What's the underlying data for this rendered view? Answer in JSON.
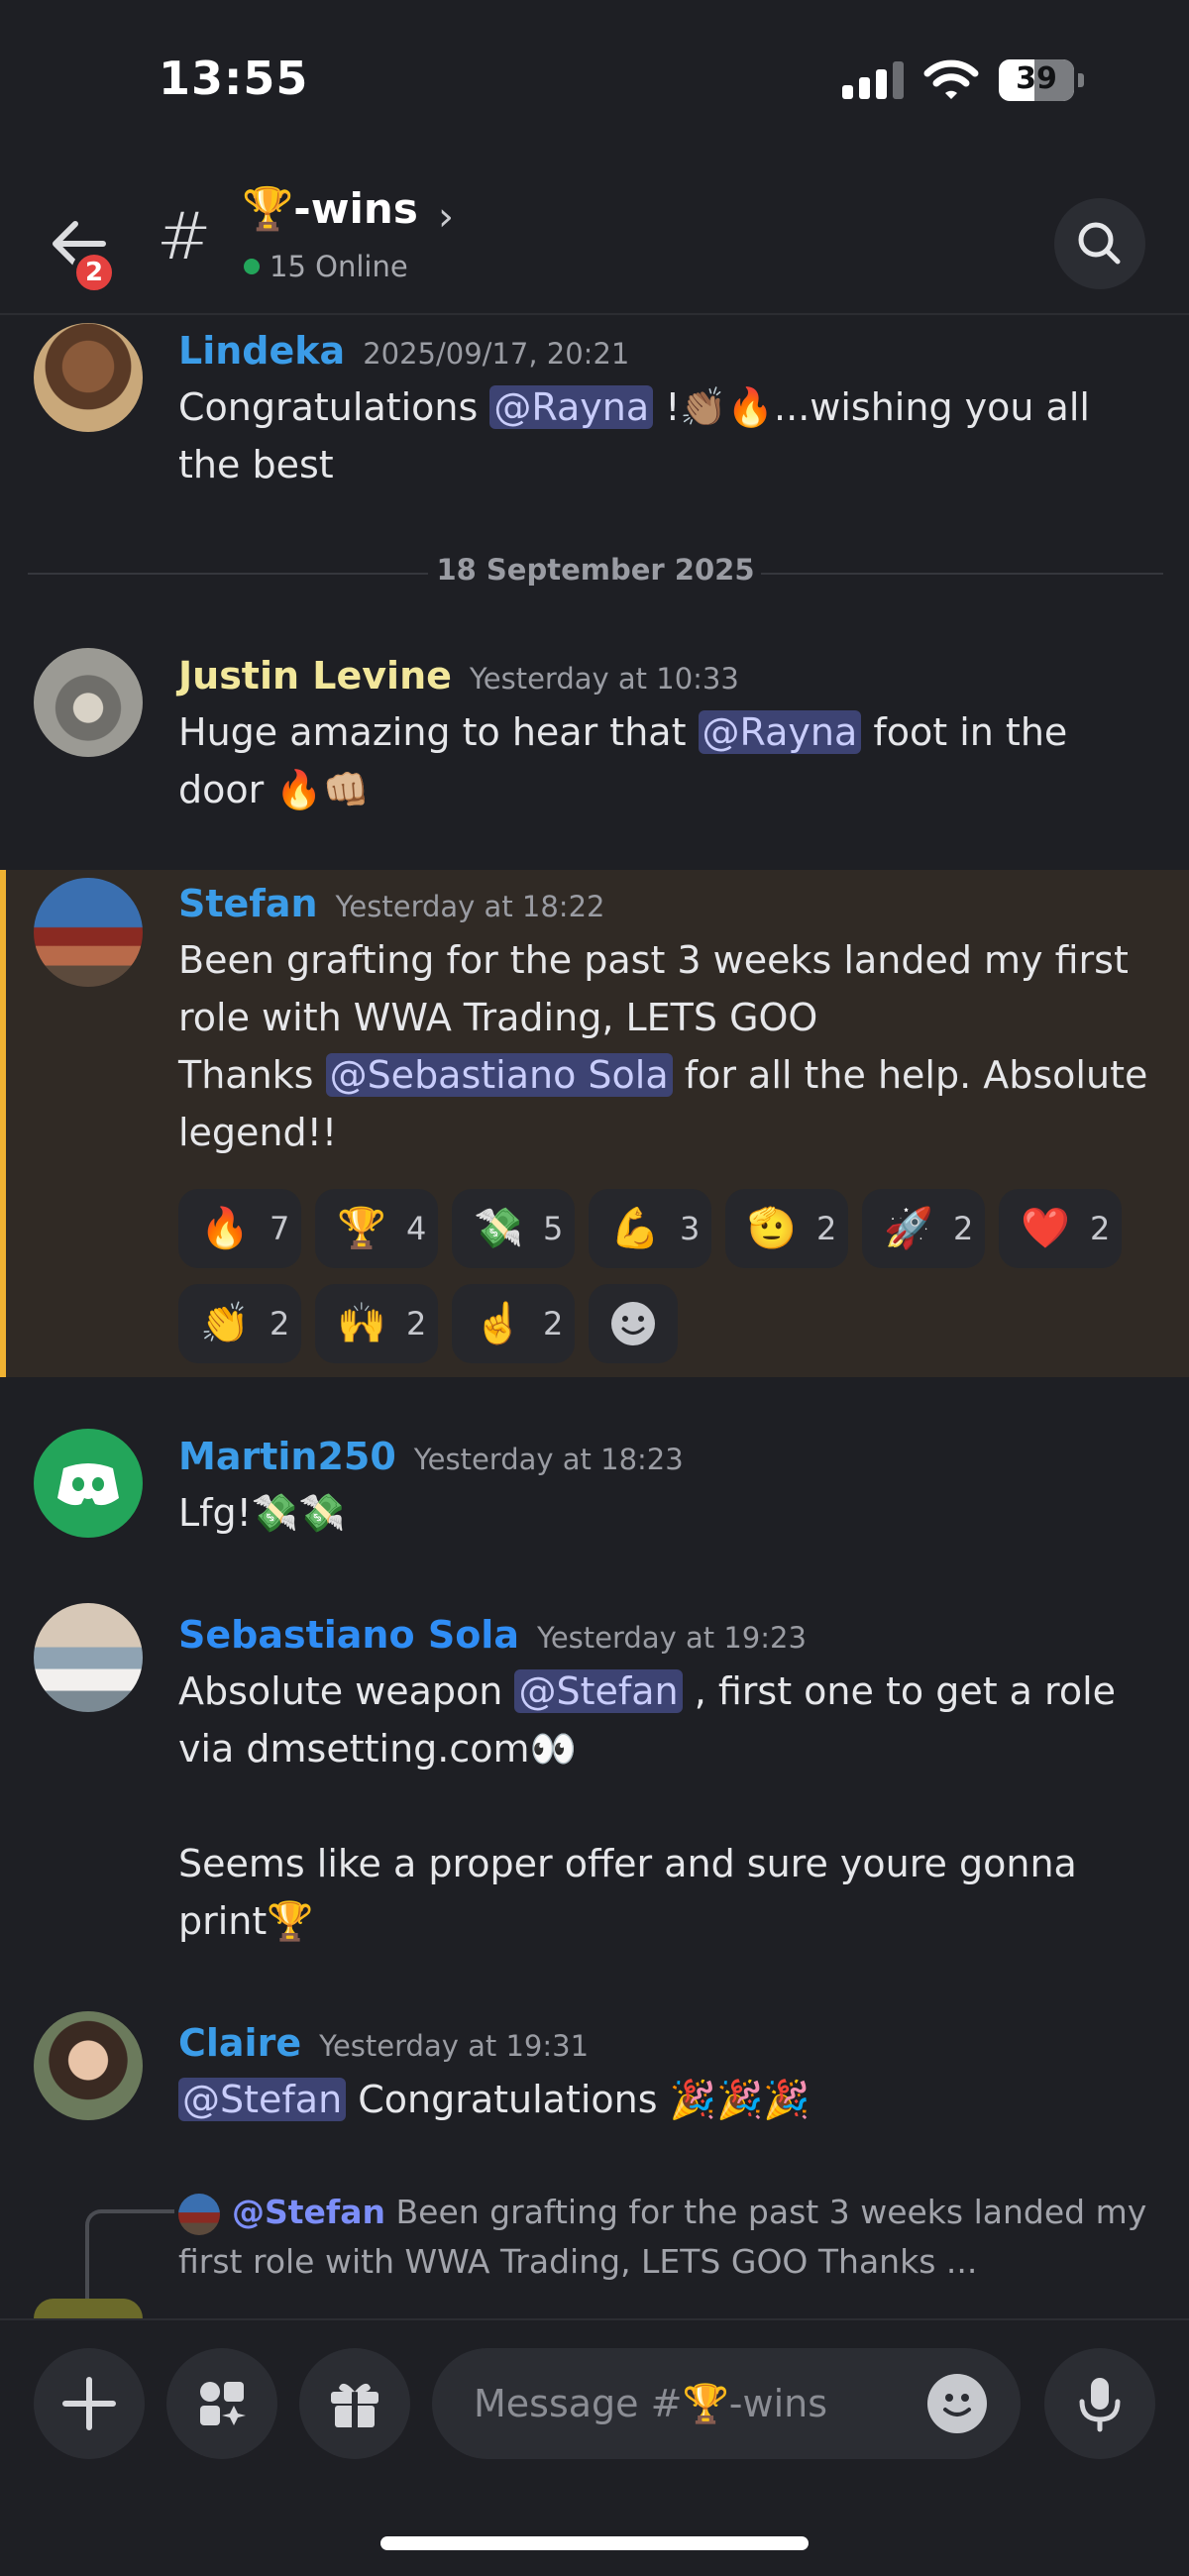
{
  "status_bar": {
    "time": "13:55",
    "battery": "39"
  },
  "header": {
    "back_badge": "2",
    "channel_name": "🏆-wins",
    "online": "15 Online"
  },
  "messages": [
    {
      "user": "Lindeka",
      "timestamp": "2025/09/17, 20:21",
      "text_a": "Congratulations ",
      "mention": "@Rayna",
      "text_b": " !👏🏽🔥...wishing you all the best"
    },
    {
      "user": "Justin Levine",
      "timestamp": "Yesterday at 10:33",
      "text_a": "Huge amazing to hear that ",
      "mention": "@Rayna",
      "text_b": " foot in the door 🔥👊🏼"
    },
    {
      "user": "Stefan",
      "timestamp": "Yesterday at 18:22",
      "line1": "Been grafting for the past 3 weeks landed my first role with WWA Trading, LETS GOO",
      "text_a": "Thanks ",
      "mention": "@Sebastiano Sola",
      "text_b": " for all the help. Absolute legend!!"
    },
    {
      "user": "Martin250",
      "timestamp": "Yesterday at 18:23",
      "text": "Lfg!💸💸"
    },
    {
      "user": "Sebastiano Sola",
      "timestamp": "Yesterday at 19:23",
      "text_a": "Absolute weapon ",
      "mention": "@Stefan",
      "text_b": " , first one to get a role via dmsetting.com👀",
      "text_c": "Seems like a proper offer and sure youre gonna print🏆"
    },
    {
      "user": "Claire",
      "timestamp": "Yesterday at 19:31",
      "mention": "@Stefan",
      "text_b": " Congratulations 🎉🎉🎉"
    }
  ],
  "date_divider": "18 September 2025",
  "reactions": [
    {
      "emoji": "🔥",
      "count": "7"
    },
    {
      "emoji": "🏆",
      "count": "4"
    },
    {
      "emoji": "💸",
      "count": "5"
    },
    {
      "emoji": "💪",
      "count": "3"
    },
    {
      "emoji": "🫡",
      "count": "2"
    },
    {
      "emoji": "🚀",
      "count": "2"
    },
    {
      "emoji": "❤️",
      "count": "2"
    },
    {
      "emoji": "👏",
      "count": "2"
    },
    {
      "emoji": "🙌",
      "count": "2"
    },
    {
      "emoji": "☝️",
      "count": "2"
    }
  ],
  "reply": {
    "who": "@Stefan",
    "text": " Been grafting for the past 3 weeks landed my first role with WWA Trading, LETS GOO Thanks ..."
  },
  "composer": {
    "placeholder": "Message #🏆-wins"
  },
  "colors": {
    "background": "#1e1f24",
    "mention_bg": "#3d4373",
    "highlight_bg": "#302a25",
    "highlight_border": "#f0b232",
    "user_lindeka": "#3b9ce8",
    "user_justin": "#f2e79b",
    "user_stefan": "#3b9ce8",
    "user_martin": "#3b9ce8",
    "user_sebastiano": "#2f8df5",
    "user_claire": "#3b9ce8",
    "online_dot": "#23a55a",
    "badge": "#e5413f"
  }
}
